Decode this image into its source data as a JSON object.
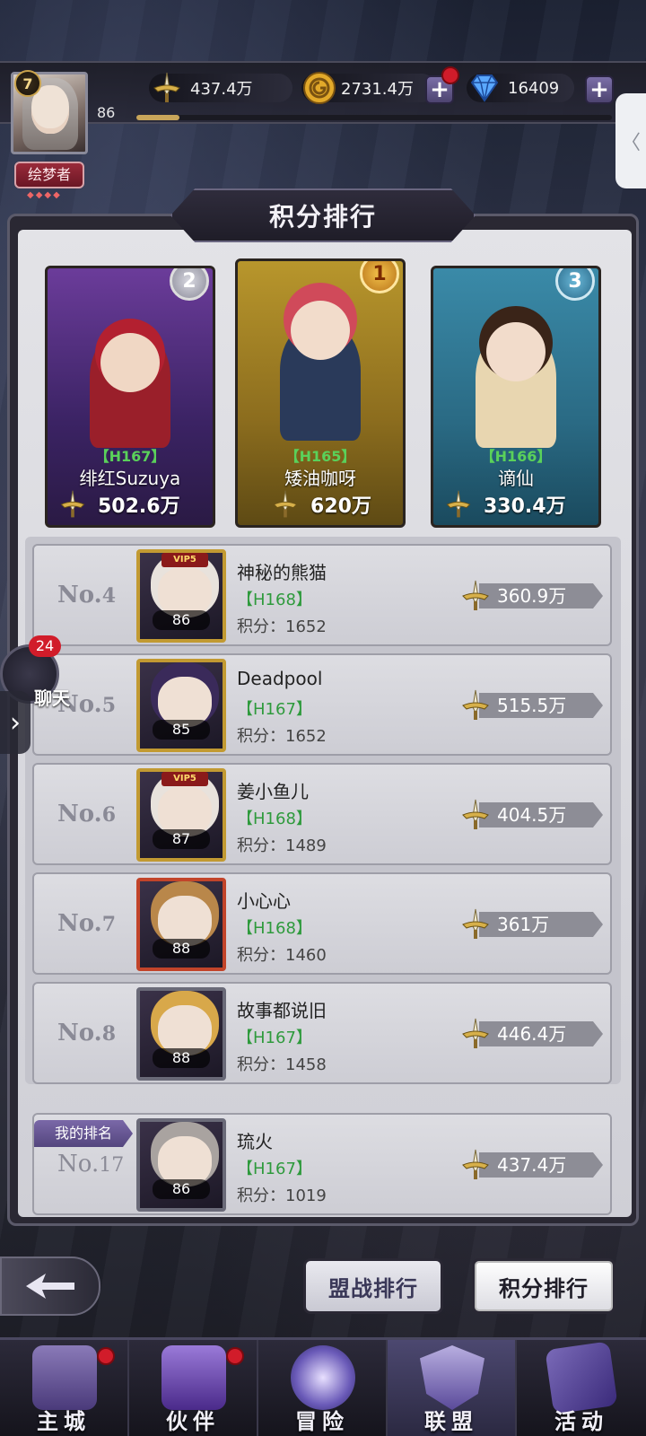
{
  "player": {
    "level": "7",
    "exp_level_text": "86",
    "exp_progress": 0.09,
    "title": "绘梦者"
  },
  "resources": {
    "power": "437.4万",
    "gold": "2731.4万",
    "diamond": "16409"
  },
  "panel": {
    "title": "积分排行"
  },
  "top3": [
    {
      "rank": "2",
      "level_text": "【H167】",
      "name": "绯红Suzuya",
      "power": "502.6万"
    },
    {
      "rank": "1",
      "level_text": "【H165】",
      "name": "矮油咖呀",
      "power": "620万"
    },
    {
      "rank": "3",
      "level_text": "【H166】",
      "name": "谪仙",
      "power": "330.4万"
    }
  ],
  "rows": [
    {
      "no_prefix": "No.",
      "no_num": "4",
      "avatar_level": "86",
      "vip": "VIP5",
      "name": "神秘的熊猫",
      "level_text": "【H168】",
      "score": "积分：1652",
      "power": "360.9万"
    },
    {
      "no_prefix": "No.",
      "no_num": "5",
      "avatar_level": "85",
      "vip": "",
      "name": "Deadpool",
      "level_text": "【H167】",
      "score": "积分：1652",
      "power": "515.5万"
    },
    {
      "no_prefix": "No.",
      "no_num": "6",
      "avatar_level": "87",
      "vip": "VIP5",
      "name": "姜小鱼儿",
      "level_text": "【H168】",
      "score": "积分：1489",
      "power": "404.5万"
    },
    {
      "no_prefix": "No.",
      "no_num": "7",
      "avatar_level": "88",
      "vip": "",
      "name": "小心心",
      "level_text": "【H168】",
      "score": "积分：1460",
      "power": "361万"
    },
    {
      "no_prefix": "No.",
      "no_num": "8",
      "avatar_level": "88",
      "vip": "",
      "name": "故事都说旧",
      "level_text": "【H167】",
      "score": "积分：1458",
      "power": "446.4万"
    }
  ],
  "my_rank": {
    "tag": "我的排名",
    "no_prefix": "No.",
    "no_num": "17",
    "avatar_level": "86",
    "name": "琉火",
    "level_text": "【H167】",
    "score": "积分：1019",
    "power": "437.4万"
  },
  "chat": {
    "badge": "24",
    "label": "聊天"
  },
  "tabs": {
    "alliance_war": "盟战排行",
    "points": "积分排行"
  },
  "nav": [
    {
      "label": "主城",
      "icon": "castle-icon",
      "dot": true
    },
    {
      "label": "伙伴",
      "icon": "witch-hat-icon",
      "dot": true
    },
    {
      "label": "冒险",
      "icon": "compass-icon",
      "dot": false
    },
    {
      "label": "联盟",
      "icon": "shield-icon",
      "dot": false,
      "active": true
    },
    {
      "label": "活动",
      "icon": "cards-icon",
      "dot": false
    }
  ],
  "colors": {
    "gold_accent": "#c29a32",
    "level_green": "#2e9a3c",
    "red_dot": "#d11c2a",
    "panel_bg": "#2a2833"
  }
}
